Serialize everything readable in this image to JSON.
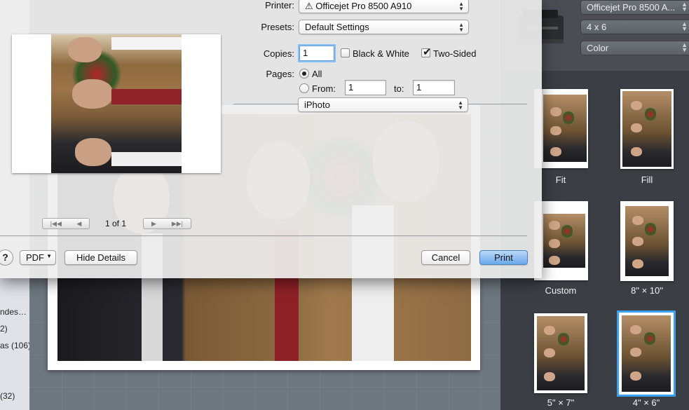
{
  "sheet": {
    "printer_label": "Printer:",
    "printer_value": "Officejet Pro 8500 A910",
    "presets_label": "Presets:",
    "presets_value": "Default Settings",
    "copies_label": "Copies:",
    "copies_value": "1",
    "bw_label": "Black & White",
    "bw_checked": false,
    "two_sided_label": "Two-Sided",
    "two_sided_checked": true,
    "pages_label": "Pages:",
    "all_label": "All",
    "from_label": "From:",
    "from_value": "1",
    "to_label": "to:",
    "to_value": "1",
    "app_section": "iPhoto",
    "page_indicator": "1 of 1",
    "help_label": "?",
    "pdf_label": "PDF",
    "hide_details_label": "Hide Details",
    "cancel_label": "Cancel",
    "print_label": "Print"
  },
  "right_panel": {
    "printer_select": "Officejet Pro 8500 A...",
    "size_select": "4 x 6",
    "color_select": "Color",
    "thumbnails": [
      {
        "label": "Fit"
      },
      {
        "label": "Fill"
      },
      {
        "label": "Custom"
      },
      {
        "label": "8\" × 10\""
      },
      {
        "label": "5\" × 7\""
      },
      {
        "label": "4\" × 6\""
      }
    ]
  },
  "sidebar": {
    "items": [
      "ndes…",
      "2)",
      "as (106)",
      "(32)"
    ]
  },
  "colors": {
    "accent": "#3aa0ef",
    "default_button": "#6aa8ea"
  },
  "icons": {
    "printer": "printer-warning-icon",
    "popup_arrows": "updown-chevron-icon",
    "first_page": "first-page-icon",
    "prev_page": "prev-page-icon",
    "next_page": "next-page-icon",
    "last_page": "last-page-icon"
  }
}
